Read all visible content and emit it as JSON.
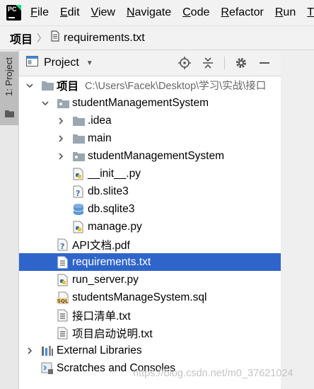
{
  "menu": {
    "items": [
      {
        "mnemonic": "F",
        "rest": "ile"
      },
      {
        "mnemonic": "E",
        "rest": "dit"
      },
      {
        "mnemonic": "V",
        "rest": "iew"
      },
      {
        "mnemonic": "N",
        "rest": "avigate"
      },
      {
        "mnemonic": "C",
        "rest": "ode"
      },
      {
        "mnemonic": "R",
        "rest": "efactor"
      },
      {
        "mnemonic": "R",
        "rest": "un"
      },
      {
        "mnemonic": "T",
        "rest": ""
      }
    ],
    "logo_text": "PC"
  },
  "breadcrumb": {
    "root": "项目",
    "file": "requirements.txt"
  },
  "side_strip": {
    "tab_label": "1: Project"
  },
  "panel": {
    "title": "Project"
  },
  "tree": {
    "root": {
      "label": "项目",
      "path": "C:\\Users\\Facek\\Desktop\\学习\\实战\\接口"
    },
    "items": [
      {
        "label": "studentManagementSystem",
        "icon": "folder-icon"
      },
      {
        "label": ".idea",
        "icon": "folder-icon"
      },
      {
        "label": "main",
        "icon": "folder-icon"
      },
      {
        "label": "studentManagementSystem",
        "icon": "folder-icon"
      },
      {
        "label": "__init__.py",
        "icon": "python-file-icon"
      },
      {
        "label": "db.slite3",
        "icon": "unknown-file-icon"
      },
      {
        "label": "db.sqlite3",
        "icon": "database-icon"
      },
      {
        "label": "manage.py",
        "icon": "python-file-icon"
      },
      {
        "label": "API文档.pdf",
        "icon": "unknown-file-icon"
      },
      {
        "label": "requirements.txt",
        "icon": "text-file-icon"
      },
      {
        "label": "run_server.py",
        "icon": "python-file-icon"
      },
      {
        "label": "studentsManageSystem.sql",
        "icon": "sql-file-icon",
        "badge": "SQL"
      },
      {
        "label": "接口清单.txt",
        "icon": "text-file-icon"
      },
      {
        "label": "项目启动说明.txt",
        "icon": "text-file-icon"
      },
      {
        "label": "External Libraries",
        "icon": "libraries-icon"
      },
      {
        "label": "Scratches and Consoles",
        "icon": "scratches-icon"
      }
    ]
  },
  "watermark": "https://blog.csdn.net/m0_37621024",
  "colors": {
    "selection": "#2f65ca",
    "folder": "#9aa7b0",
    "python_blue": "#3572a5",
    "python_yellow": "#f0c419",
    "chrome_bg": "#f2f2f2"
  }
}
